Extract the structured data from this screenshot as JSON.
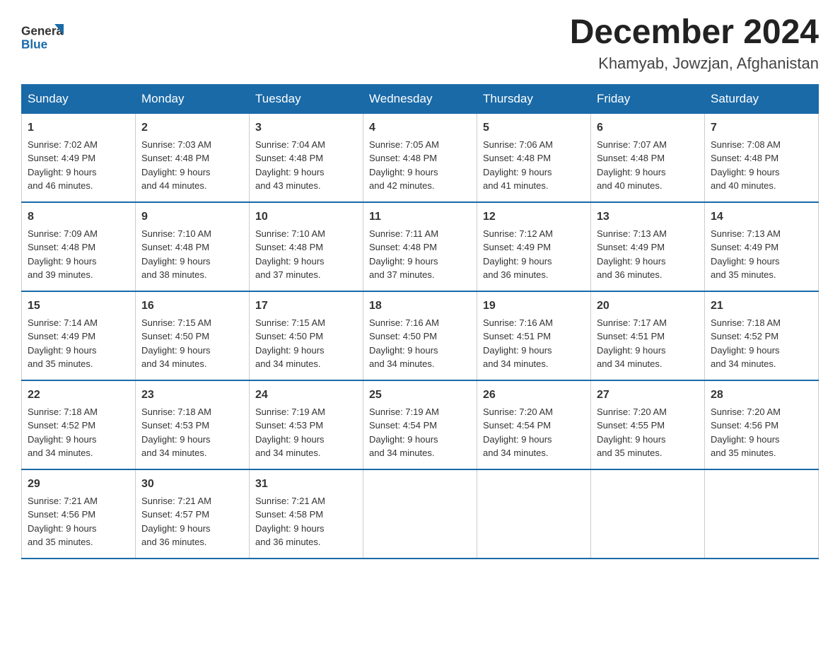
{
  "header": {
    "logo_general": "General",
    "logo_blue": "Blue",
    "month_title": "December 2024",
    "location": "Khamyab, Jowzjan, Afghanistan"
  },
  "days_of_week": [
    "Sunday",
    "Monday",
    "Tuesday",
    "Wednesday",
    "Thursday",
    "Friday",
    "Saturday"
  ],
  "weeks": [
    [
      {
        "day": "1",
        "sunrise": "7:02 AM",
        "sunset": "4:49 PM",
        "daylight": "9 hours and 46 minutes."
      },
      {
        "day": "2",
        "sunrise": "7:03 AM",
        "sunset": "4:48 PM",
        "daylight": "9 hours and 44 minutes."
      },
      {
        "day": "3",
        "sunrise": "7:04 AM",
        "sunset": "4:48 PM",
        "daylight": "9 hours and 43 minutes."
      },
      {
        "day": "4",
        "sunrise": "7:05 AM",
        "sunset": "4:48 PM",
        "daylight": "9 hours and 42 minutes."
      },
      {
        "day": "5",
        "sunrise": "7:06 AM",
        "sunset": "4:48 PM",
        "daylight": "9 hours and 41 minutes."
      },
      {
        "day": "6",
        "sunrise": "7:07 AM",
        "sunset": "4:48 PM",
        "daylight": "9 hours and 40 minutes."
      },
      {
        "day": "7",
        "sunrise": "7:08 AM",
        "sunset": "4:48 PM",
        "daylight": "9 hours and 40 minutes."
      }
    ],
    [
      {
        "day": "8",
        "sunrise": "7:09 AM",
        "sunset": "4:48 PM",
        "daylight": "9 hours and 39 minutes."
      },
      {
        "day": "9",
        "sunrise": "7:10 AM",
        "sunset": "4:48 PM",
        "daylight": "9 hours and 38 minutes."
      },
      {
        "day": "10",
        "sunrise": "7:10 AM",
        "sunset": "4:48 PM",
        "daylight": "9 hours and 37 minutes."
      },
      {
        "day": "11",
        "sunrise": "7:11 AM",
        "sunset": "4:48 PM",
        "daylight": "9 hours and 37 minutes."
      },
      {
        "day": "12",
        "sunrise": "7:12 AM",
        "sunset": "4:49 PM",
        "daylight": "9 hours and 36 minutes."
      },
      {
        "day": "13",
        "sunrise": "7:13 AM",
        "sunset": "4:49 PM",
        "daylight": "9 hours and 36 minutes."
      },
      {
        "day": "14",
        "sunrise": "7:13 AM",
        "sunset": "4:49 PM",
        "daylight": "9 hours and 35 minutes."
      }
    ],
    [
      {
        "day": "15",
        "sunrise": "7:14 AM",
        "sunset": "4:49 PM",
        "daylight": "9 hours and 35 minutes."
      },
      {
        "day": "16",
        "sunrise": "7:15 AM",
        "sunset": "4:50 PM",
        "daylight": "9 hours and 34 minutes."
      },
      {
        "day": "17",
        "sunrise": "7:15 AM",
        "sunset": "4:50 PM",
        "daylight": "9 hours and 34 minutes."
      },
      {
        "day": "18",
        "sunrise": "7:16 AM",
        "sunset": "4:50 PM",
        "daylight": "9 hours and 34 minutes."
      },
      {
        "day": "19",
        "sunrise": "7:16 AM",
        "sunset": "4:51 PM",
        "daylight": "9 hours and 34 minutes."
      },
      {
        "day": "20",
        "sunrise": "7:17 AM",
        "sunset": "4:51 PM",
        "daylight": "9 hours and 34 minutes."
      },
      {
        "day": "21",
        "sunrise": "7:18 AM",
        "sunset": "4:52 PM",
        "daylight": "9 hours and 34 minutes."
      }
    ],
    [
      {
        "day": "22",
        "sunrise": "7:18 AM",
        "sunset": "4:52 PM",
        "daylight": "9 hours and 34 minutes."
      },
      {
        "day": "23",
        "sunrise": "7:18 AM",
        "sunset": "4:53 PM",
        "daylight": "9 hours and 34 minutes."
      },
      {
        "day": "24",
        "sunrise": "7:19 AM",
        "sunset": "4:53 PM",
        "daylight": "9 hours and 34 minutes."
      },
      {
        "day": "25",
        "sunrise": "7:19 AM",
        "sunset": "4:54 PM",
        "daylight": "9 hours and 34 minutes."
      },
      {
        "day": "26",
        "sunrise": "7:20 AM",
        "sunset": "4:54 PM",
        "daylight": "9 hours and 34 minutes."
      },
      {
        "day": "27",
        "sunrise": "7:20 AM",
        "sunset": "4:55 PM",
        "daylight": "9 hours and 35 minutes."
      },
      {
        "day": "28",
        "sunrise": "7:20 AM",
        "sunset": "4:56 PM",
        "daylight": "9 hours and 35 minutes."
      }
    ],
    [
      {
        "day": "29",
        "sunrise": "7:21 AM",
        "sunset": "4:56 PM",
        "daylight": "9 hours and 35 minutes."
      },
      {
        "day": "30",
        "sunrise": "7:21 AM",
        "sunset": "4:57 PM",
        "daylight": "9 hours and 36 minutes."
      },
      {
        "day": "31",
        "sunrise": "7:21 AM",
        "sunset": "4:58 PM",
        "daylight": "9 hours and 36 minutes."
      },
      null,
      null,
      null,
      null
    ]
  ],
  "labels": {
    "sunrise": "Sunrise:",
    "sunset": "Sunset:",
    "daylight": "Daylight:"
  }
}
